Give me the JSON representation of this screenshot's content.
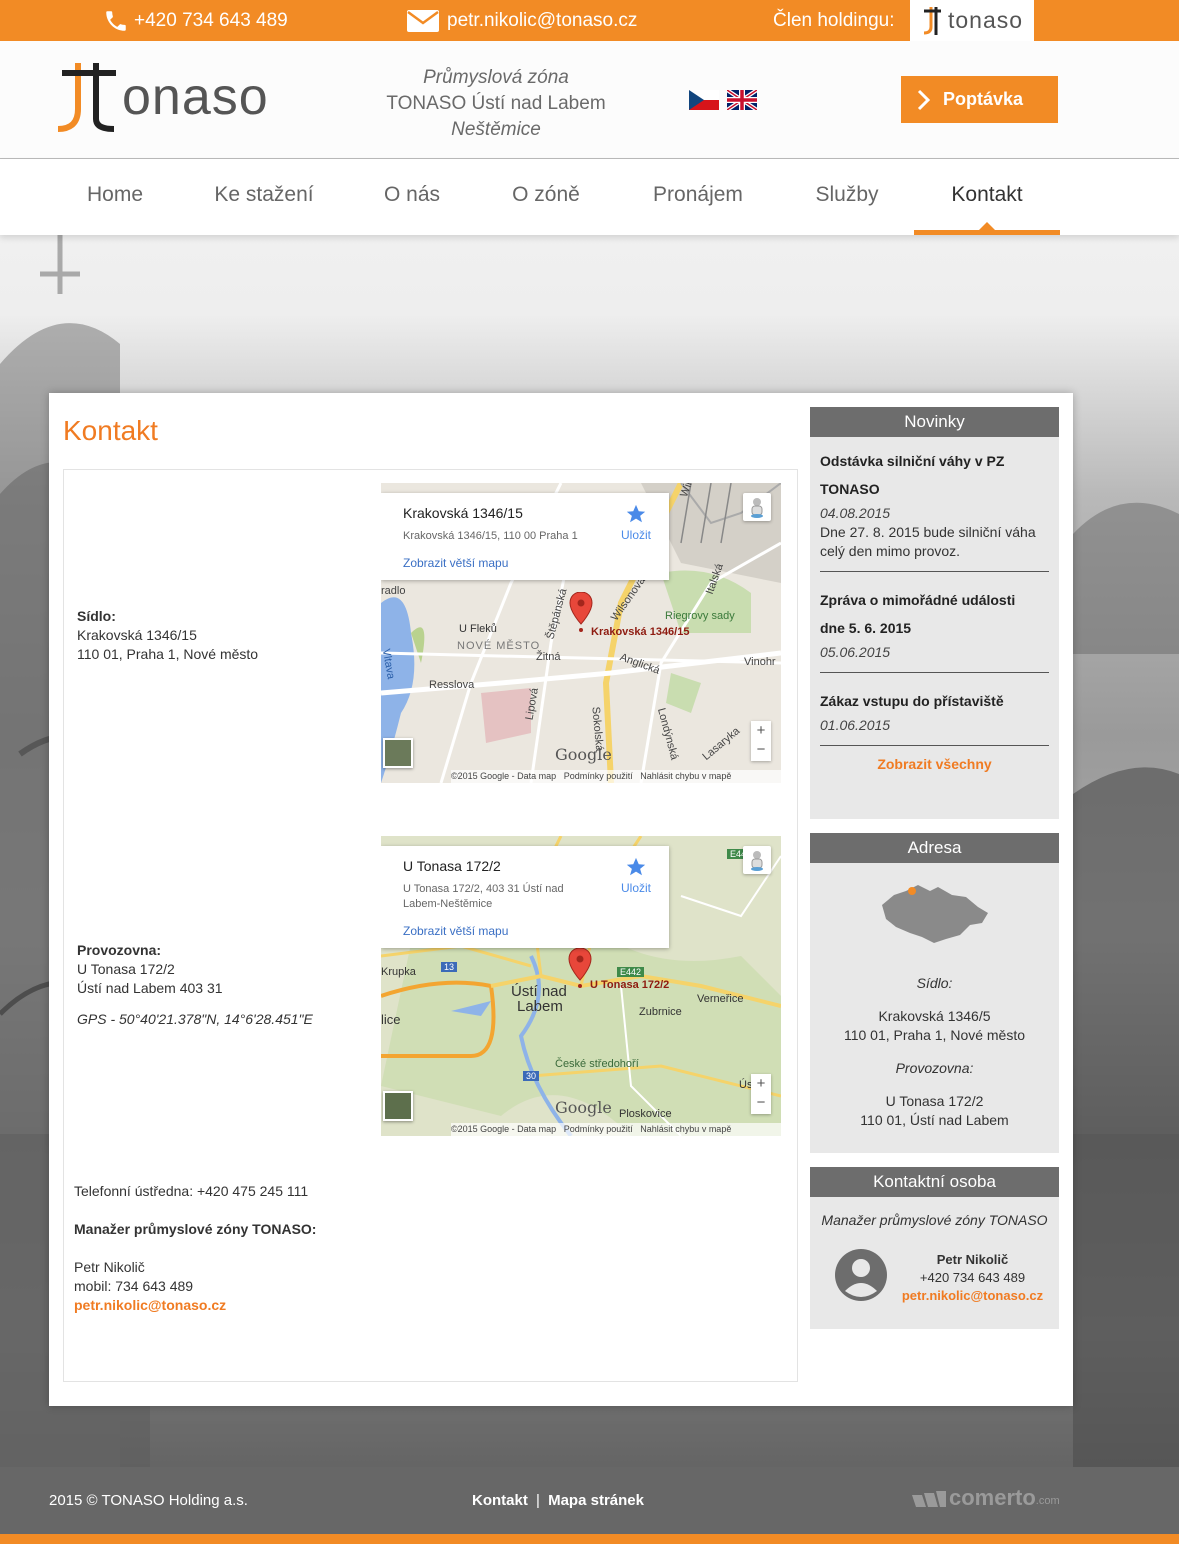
{
  "topbar": {
    "phone": "+420 734 643 489",
    "email": "petr.nikolic@tonaso.cz",
    "holding_label": "Člen holdingu:",
    "holding_logo_text": "tonaso"
  },
  "header": {
    "logo_text": "onaso",
    "zona_line1": "Průmyslová zóna",
    "zona_line2": "TONASO Ústí nad Labem",
    "zona_line3": "Neštěmice",
    "cta": "Poptávka"
  },
  "nav": [
    {
      "label": "Home"
    },
    {
      "label": "Ke stažení"
    },
    {
      "label": "O nás"
    },
    {
      "label": "O zóně"
    },
    {
      "label": "Pronájem"
    },
    {
      "label": "Služby"
    },
    {
      "label": "Kontakt",
      "active": true
    }
  ],
  "main": {
    "title": "Kontakt",
    "sidlo": {
      "label": "Sídlo:",
      "line1": "Krakovská 1346/15",
      "line2": "110 01, Praha 1, Nové město"
    },
    "provozovna": {
      "label": "Provozovna:",
      "line1": "U Tonasa 172/2",
      "line2": "Ústí nad Labem 403 31",
      "gps": "GPS - 50°40'21.378\"N, 14°6'28.451\"E"
    },
    "map1": {
      "title": "Krakovská 1346/15",
      "address": "Krakovská 1346/15, 110 00 Praha 1",
      "save": "Uložit",
      "larger": "Zobrazit větší mapu",
      "marker": "Krakovská 1346/15",
      "labels": {
        "l1": "U Fleků",
        "l2": "NOVÉ MĚSTO",
        "l3": "Žitná",
        "l4": "Resslova",
        "l5": "Riegrovy sady",
        "l6": "Vinohr",
        "l7": "Anglická",
        "l8": "Wilsonova",
        "l9": "Štěpánská",
        "l10": "Sokolská",
        "l11": "Lipová",
        "l12": "Londýnská",
        "l13": "Vltava",
        "l14": "Italská",
        "l15": "Lasaryka",
        "l16": "radlo",
        "l17": "Wils"
      },
      "google": "Google",
      "footer": "©2015 Google - Data map",
      "footer2": "Podmínky použití",
      "footer3": "Nahlásit chybu v mapě"
    },
    "map2": {
      "title": "U Tonasa 172/2",
      "address": "U Tonasa 172/2, 403 31 Ústí nad Labem-Neštěmice",
      "save": "Uložit",
      "larger": "Zobrazit větší mapu",
      "marker": "U Tonasa 172/2",
      "labels": {
        "l1": "Krupka",
        "l2": "Ústí nad",
        "l3": "Labem",
        "l4": "Zubrnice",
        "l5": "Verneřice",
        "l6": "České středohoří",
        "l7": "Ploskovice",
        "l8": "lice",
        "l9": "E442",
        "l10": "13",
        "l11": "30",
        "l12": "E44",
        "l13": "Ús"
      },
      "google": "Google",
      "footer": "©2015 Google - Data map",
      "footer2": "Podmínky použití",
      "footer3": "Nahlásit chybu v mapě"
    },
    "phone_central": "Telefonní ústředna: +420 475 245 111",
    "manager_heading": "Manažer průmyslové zóny TONASO:",
    "manager_name": "Petr Nikolič",
    "manager_mobile": "mobil: 734 643 489",
    "manager_email": "petr.nikolic@tonaso.cz"
  },
  "sidebar": {
    "news_title": "Novinky",
    "news": [
      {
        "title_l1": "Odstávka silniční váhy v PZ",
        "title_l2": "TONASO",
        "date": "04.08.2015",
        "text_l1": "Dne 27. 8. 2015 bude silniční váha",
        "text_l2": "celý den mimo provoz."
      },
      {
        "title_l1": "Zpráva o mimořádné události",
        "title_l2": "dne 5. 6. 2015",
        "date": "05.06.2015"
      },
      {
        "title_l1": "Zákaz vstupu do přístaviště",
        "date": "01.06.2015"
      }
    ],
    "news_all": "Zobrazit všechny",
    "address_title": "Adresa",
    "addr_sidlo_label": "Sídlo:",
    "addr_sidlo_l1": "Krakovská 1346/5",
    "addr_sidlo_l2": "110 01, Praha 1, Nové město",
    "addr_prov_label": "Provozovna:",
    "addr_prov_l1": "U Tonasa 172/2",
    "addr_prov_l2": "110 01, Ústí nad Labem",
    "contact_title": "Kontaktní osoba",
    "contact_role": "Manažer průmyslové zóny TONASO",
    "contact_name": "Petr Nikolič",
    "contact_phone": "+420 734 643 489",
    "contact_email": "petr.nikolic@tonaso.cz"
  },
  "footer": {
    "copyright": "2015 © TONASO Holding a.s.",
    "link1": "Kontakt",
    "sep": "|",
    "link2": "Mapa stránek",
    "brand": "comerto",
    "brand_suffix": ".com"
  },
  "colors": {
    "accent": "#f28b25",
    "title": "#f07b22",
    "sidebar_head": "#6d6d6d",
    "footer": "#676767"
  }
}
